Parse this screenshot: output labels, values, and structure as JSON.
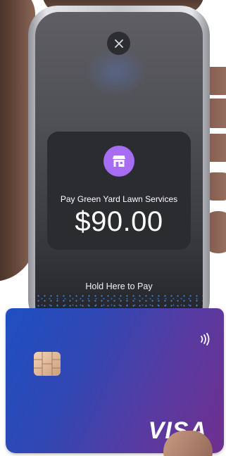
{
  "payment": {
    "title": "Pay Green Yard Lawn Services",
    "amount": "$90.00",
    "instruction": "Hold Here to Pay"
  },
  "card": {
    "brand": "VISA"
  },
  "colors": {
    "merchant_icon_bg": "#a66cf2",
    "card_gradient_start": "#1f4fc2",
    "card_gradient_end": "#6e2f8e"
  },
  "icons": {
    "close": "close-icon",
    "merchant": "store-icon",
    "contactless": "contactless-icon",
    "chip": "chip-icon"
  }
}
